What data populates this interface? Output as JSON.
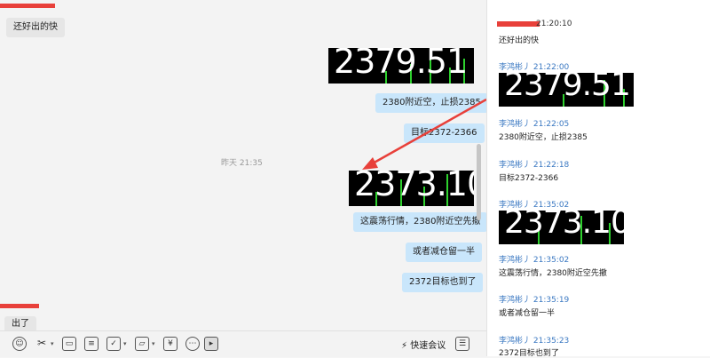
{
  "chat": {
    "left_messages": [
      "还好出的快",
      "出了"
    ],
    "timestamp": "昨天 21:35",
    "price_images": [
      "2379.51",
      "2373.10"
    ],
    "right_messages": [
      "2380附近空，止损2385",
      "目标2372-2366",
      "这震荡行情，2380附近空先撤",
      "或者减仓留一半",
      "2372目标也到了"
    ]
  },
  "toolbar": {
    "icons": [
      "emoji-icon",
      "scissors-icon",
      "image-icon",
      "document-icon",
      "checklist-icon",
      "folder-icon",
      "yen-icon",
      "more-icon",
      "screen-share-icon",
      "lightning-icon",
      "history-icon"
    ],
    "quick_meeting_label": "快速会议"
  },
  "side": {
    "top_time": "21:20:10",
    "top_text": "还好出的快",
    "entries": [
      {
        "meta": "李鸿彬丿 21:22:00",
        "price": "2379.51"
      },
      {
        "meta": "李鸿彬丿 21:22:05",
        "text": "2380附近空，止损2385"
      },
      {
        "meta": "李鸿彬丿 21:22:18",
        "text": "目标2372-2366"
      },
      {
        "meta": "李鸿彬丿 21:35:02",
        "price": "2373.10"
      },
      {
        "meta": "李鸿彬丿 21:35:02",
        "text": "这震荡行情，2380附近空先撤"
      },
      {
        "meta": "李鸿彬丿 21:35:19",
        "text": "或者减仓留一半"
      },
      {
        "meta": "李鸿彬丿 21:35:23",
        "text": "2372目标也到了"
      }
    ]
  },
  "colors": {
    "accent_red": "#e8403a",
    "bubble_blue": "#c9e6fb",
    "name_blue": "#3a78c2",
    "chart_green": "#2ed12e"
  }
}
